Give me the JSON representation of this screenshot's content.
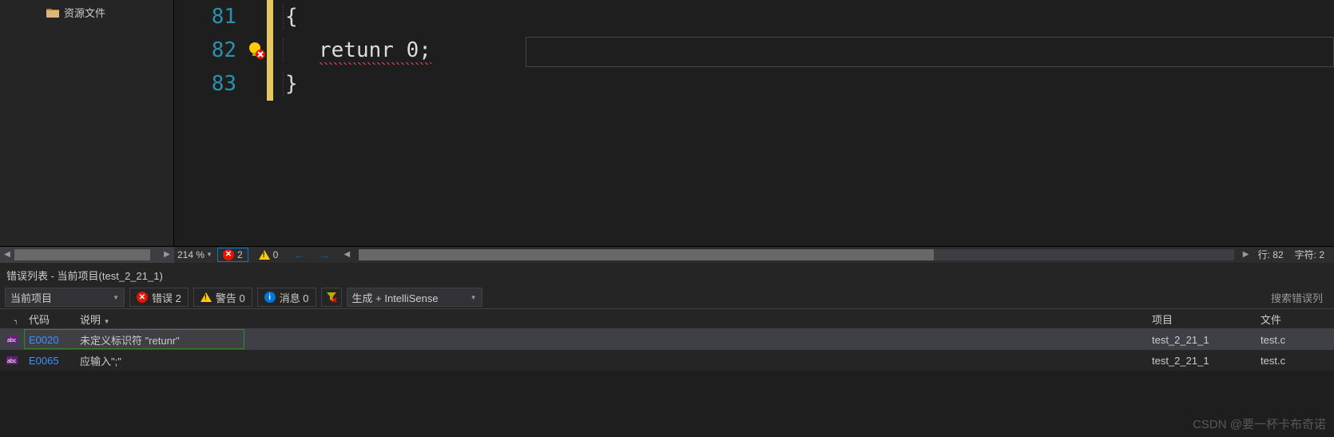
{
  "explorer": {
    "resourceFolderLabel": "资源文件"
  },
  "editor": {
    "lines": [
      {
        "num": "81",
        "text": "{"
      },
      {
        "num": "82",
        "text": "retunr 0;"
      },
      {
        "num": "83",
        "text": "}"
      }
    ]
  },
  "statusBar": {
    "zoom": "214 %",
    "errorCount": "2",
    "warningCount": "0",
    "lineLabel": "行: 82",
    "colLabel": "字符: 2"
  },
  "errorList": {
    "title": "错误列表 - 当前项目(test_2_21_1)",
    "scopeCombo": "当前项目",
    "errorsBtn": "错误 2",
    "warningsBtn": "警告 0",
    "messagesBtn": "消息 0",
    "sourceCombo": "生成 + IntelliSense",
    "searchPlaceholder": "搜索错误列",
    "columns": {
      "code": "代码",
      "desc": "说明",
      "project": "项目",
      "file": "文件"
    },
    "rows": [
      {
        "code": "E0020",
        "desc": "未定义标识符 \"retunr\"",
        "project": "test_2_21_1",
        "file": "test.c"
      },
      {
        "code": "E0065",
        "desc": "应输入\";\"",
        "project": "test_2_21_1",
        "file": "test.c"
      }
    ]
  },
  "watermark": "CSDN @要一杯卡布奇诺"
}
